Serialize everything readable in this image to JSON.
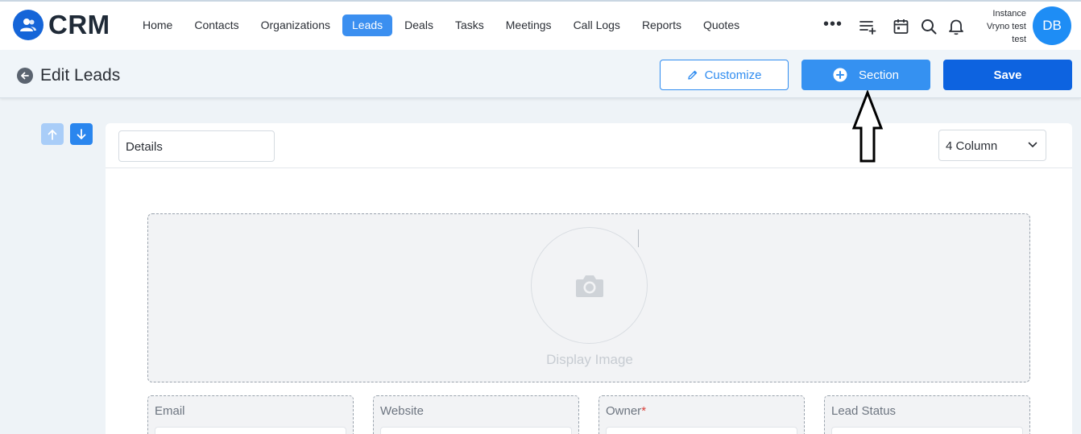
{
  "app": {
    "name": "CRM"
  },
  "nav": {
    "items": [
      {
        "label": "Home",
        "active": false
      },
      {
        "label": "Contacts",
        "active": false
      },
      {
        "label": "Organizations",
        "active": false
      },
      {
        "label": "Leads",
        "active": true
      },
      {
        "label": "Deals",
        "active": false
      },
      {
        "label": "Tasks",
        "active": false
      },
      {
        "label": "Meetings",
        "active": false
      },
      {
        "label": "Call Logs",
        "active": false
      },
      {
        "label": "Reports",
        "active": false
      },
      {
        "label": "Quotes",
        "active": false
      }
    ],
    "more_label": "•••",
    "icons": [
      "add-list-icon",
      "calendar-icon",
      "search-icon",
      "bell-icon"
    ]
  },
  "user": {
    "instance_line1": "Instance",
    "instance_line2": "Vryno test",
    "instance_line3": "test",
    "initials": "DB",
    "avatar_color": "#1e8df5"
  },
  "header": {
    "title": "Edit Leads",
    "customize_label": "Customize",
    "section_label": "Section",
    "save_label": "Save"
  },
  "section": {
    "name_value": "Details",
    "columns_value": "4 Column",
    "image_label": "Display Image"
  },
  "fields": [
    {
      "label": "Email",
      "required": ""
    },
    {
      "label": "Website",
      "required": ""
    },
    {
      "label": "Owner",
      "required": "*"
    },
    {
      "label": "Lead Status",
      "required": ""
    }
  ],
  "colors": {
    "primary": "#0d63e0",
    "accent": "#3591f1",
    "active_nav": "#3b8ff0"
  }
}
